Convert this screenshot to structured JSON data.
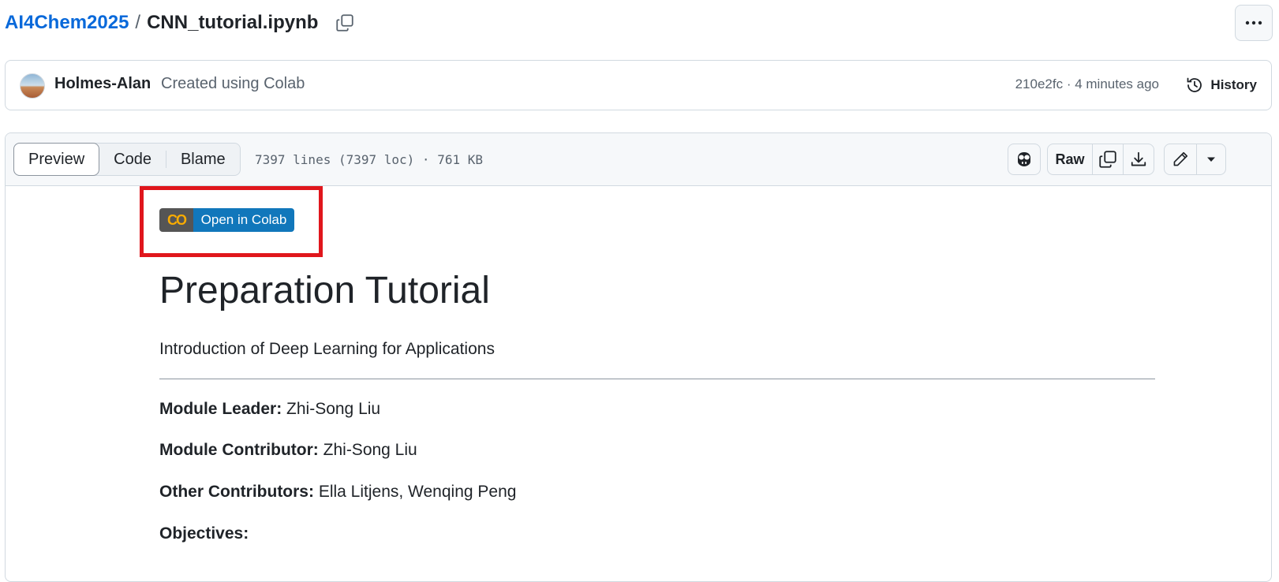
{
  "breadcrumb": {
    "repo": "AI4Chem2025",
    "separator": "/",
    "file": "CNN_tutorial.ipynb"
  },
  "commit": {
    "author": "Holmes-Alan",
    "message": "Created using Colab",
    "meta": "210e2fc · 4 minutes ago",
    "history_label": "History"
  },
  "file_header": {
    "tabs": [
      "Preview",
      "Code",
      "Blame"
    ],
    "active_tab": "Preview",
    "info": "7397 lines (7397 loc) · 761 KB",
    "raw_label": "Raw"
  },
  "notebook": {
    "badge_label": "Open in Colab",
    "badge_logo": "CO",
    "title": "Preparation Tutorial",
    "subtitle": "Introduction of Deep Learning for Applications",
    "rows": [
      {
        "label": "Module Leader:",
        "value": "Zhi-Song Liu"
      },
      {
        "label": "Module Contributor:",
        "value": "Zhi-Song Liu"
      },
      {
        "label": "Other Contributors:",
        "value": "Ella Litjens, Wenqing Peng"
      },
      {
        "label": "Objectives:",
        "value": ""
      }
    ]
  },
  "colors": {
    "link": "#0969da",
    "highlight": "#e0161c",
    "colab_blue": "#1177bb",
    "colab_orange": "#f9ab00"
  },
  "icons": [
    "copy-icon",
    "kebab-icon",
    "history-icon",
    "copilot-icon",
    "download-icon",
    "pencil-icon",
    "triangle-down-icon"
  ]
}
